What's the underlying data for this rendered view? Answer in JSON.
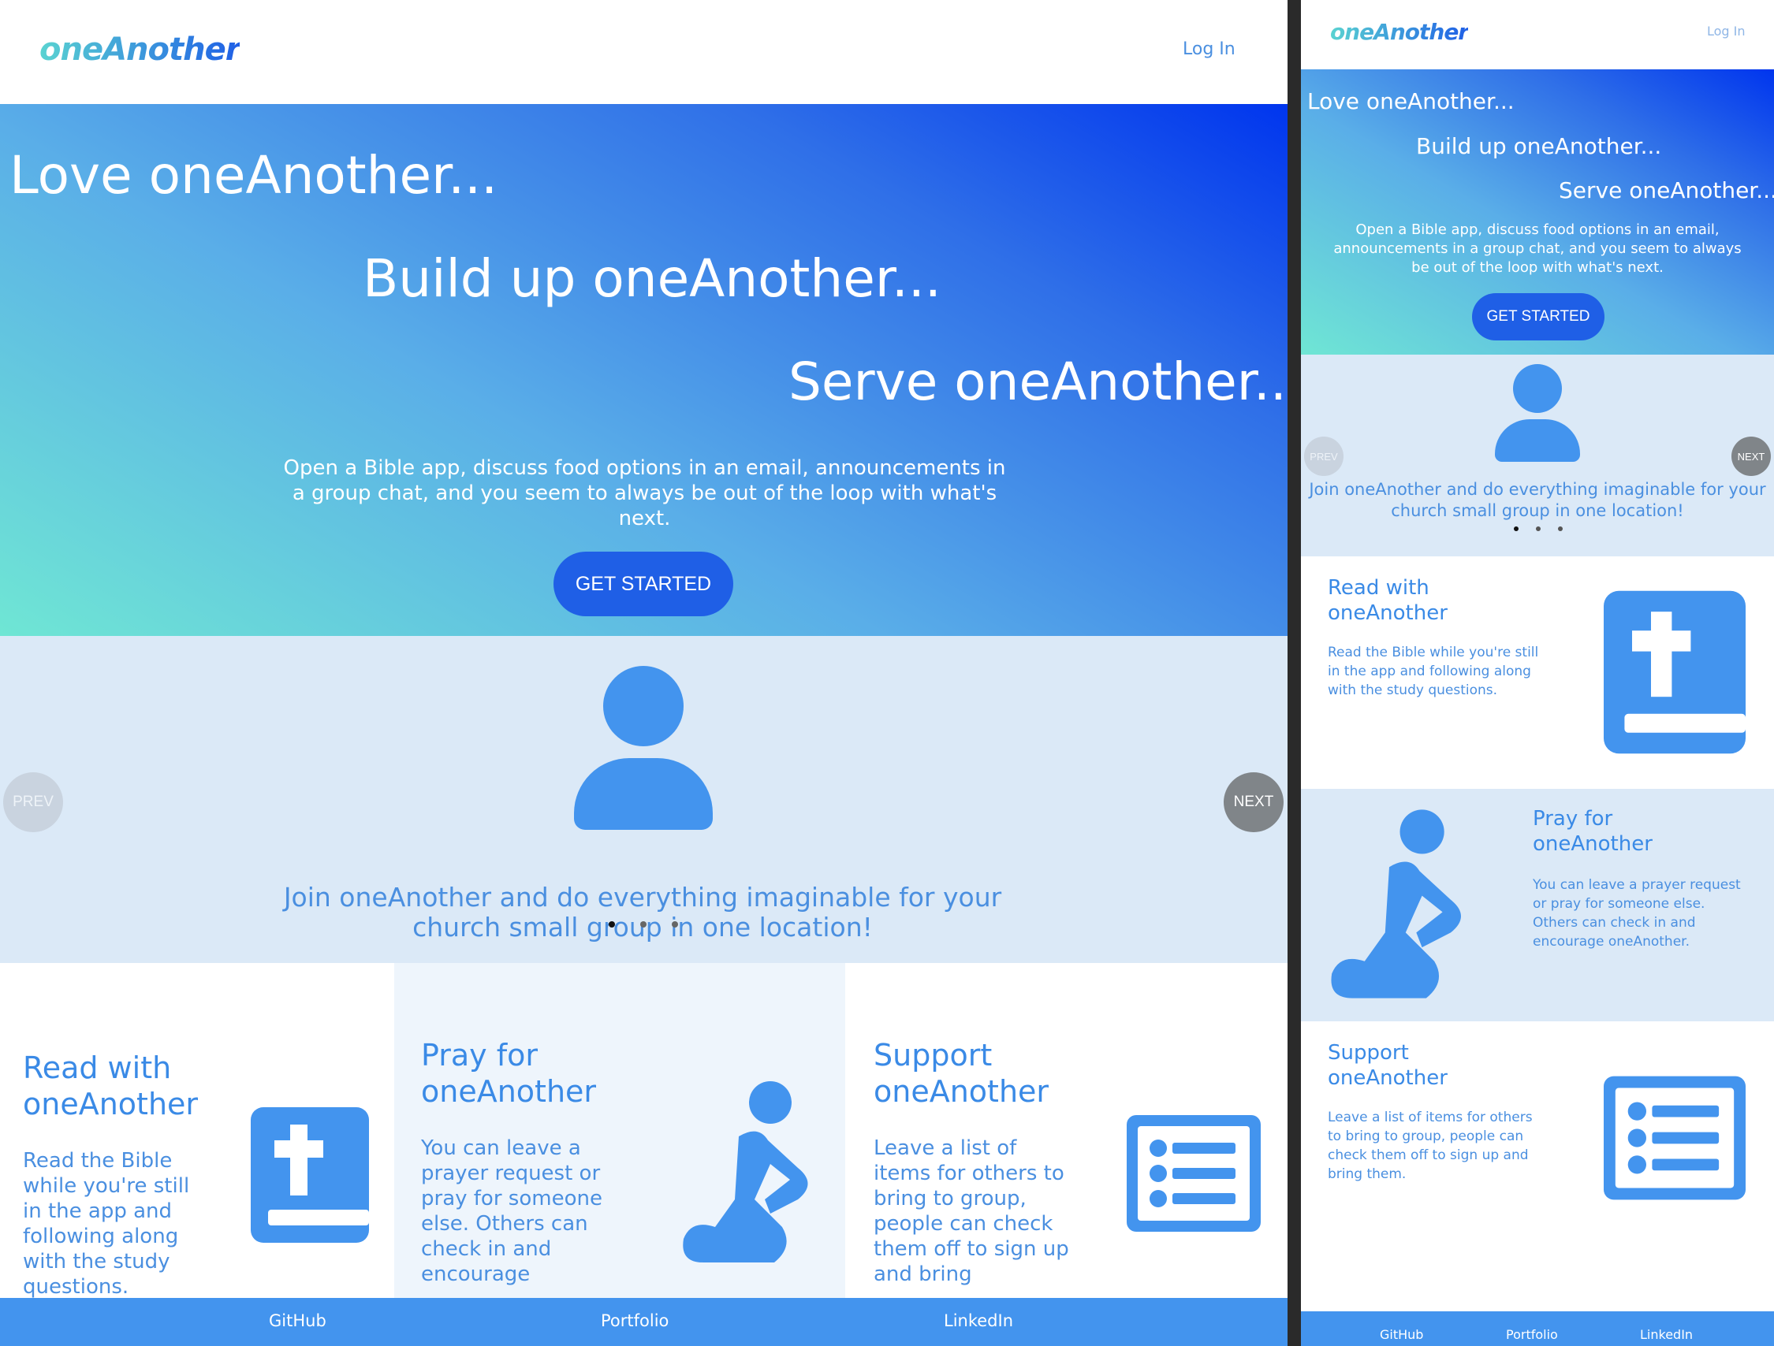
{
  "brand": {
    "logo": "oneAnother"
  },
  "nav": {
    "login": "Log In"
  },
  "hero": {
    "line1": "Love oneAnother...",
    "line2": "Build up oneAnother...",
    "line3": "Serve oneAnother...",
    "description": "Open a Bible app, discuss food options in an email, announcements in a group chat, and you seem to always be out of the loop with what's next.",
    "cta": "GET STARTED"
  },
  "carousel": {
    "prev": "PREV",
    "next": "NEXT",
    "text": "Join oneAnother and do everything imaginable for your church small group in one location!",
    "active_slide": 1,
    "slide_count": 3
  },
  "features": {
    "read": {
      "title": "Read with oneAnother",
      "text_desktop": "Read the Bible while you're still in the app and following along with the study questions.",
      "text_mobile": "Read the Bible while you're still in the app and following along with the study questions."
    },
    "pray": {
      "title": "Pray for oneAnother",
      "text_desktop": "You can leave a prayer request or pray for someone else. Others can check in and encourage",
      "text_mobile": "You can leave a prayer request or pray for someone else. Others can check in and encourage oneAnother."
    },
    "support": {
      "title": "Support oneAnother",
      "text_desktop": "Leave a list of items for others to bring to group, people can check them off to sign up and bring",
      "text_mobile": "Leave a list of items for others to bring to group, people can check them off to sign up and bring them."
    }
  },
  "footer": {
    "github": "GitHub",
    "portfolio": "Portfolio",
    "linkedin": "LinkedIn"
  },
  "colors": {
    "accent": "#4394ee",
    "cta": "#1f5fe6",
    "light_bg": "#dbe9f7",
    "text_blue": "#4a8fe0"
  },
  "icons": [
    "person-icon",
    "bible-icon",
    "praying-person-icon",
    "list-icon"
  ]
}
